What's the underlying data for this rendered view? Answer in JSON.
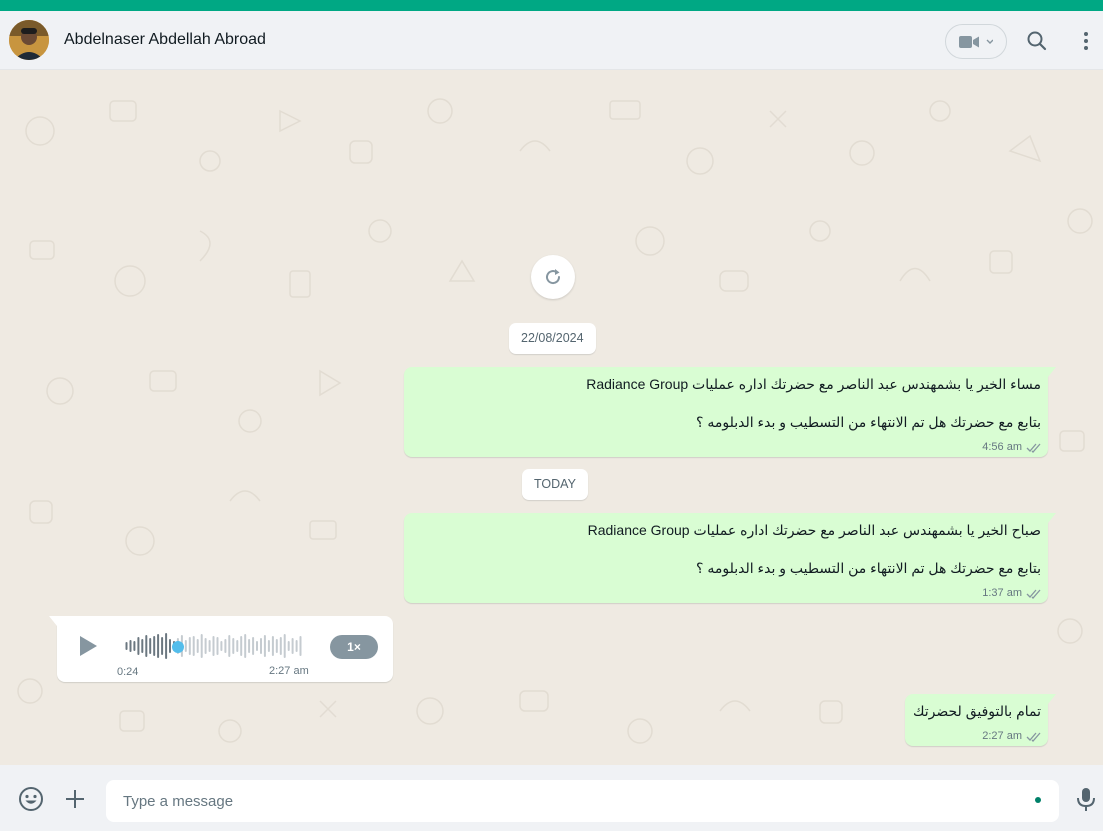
{
  "header": {
    "contact_name": "Abdelnaser Abdellah Abroad",
    "icons": [
      "avatar",
      "video-call-icon",
      "chevron-down-icon",
      "search-icon",
      "kebab-menu-icon"
    ]
  },
  "colors": {
    "accent": "#00a884",
    "outgoing_bubble": "#d9fdd3",
    "incoming_bubble": "#ffffff",
    "chat_background": "#efeae2",
    "read_ticks": "#667781",
    "voice_progress": "#53bdeb"
  },
  "chat": {
    "reload_icon": "refresh-icon",
    "date_divider_1": "22/08/2024",
    "date_divider_2": "TODAY",
    "messages": [
      {
        "direction": "outgoing",
        "line_1": "مساء الخير يا بشمهندس عبد الناصر مع  حضرتك اداره عمليات Radiance Group",
        "line_2": "بتابع مع حضرتك هل تم الانتهاء من التسطيب و بدء الدبلومه ؟",
        "time": "4:56 am",
        "status": "read"
      },
      {
        "direction": "outgoing",
        "line_1": "صباح الخير يا بشمهندس عبد الناصر مع  حضرتك اداره عمليات Radiance Group",
        "line_2": "بتابع مع حضرتك هل تم الانتهاء من التسطيب و بدء الدبلومه ؟",
        "time": "1:37 am",
        "status": "read"
      },
      {
        "direction": "incoming",
        "type": "voice",
        "duration": "0:24",
        "time": "2:27 am",
        "speed": "1×",
        "progress": 0.28
      },
      {
        "direction": "outgoing",
        "line_1": "تمام بالتوفيق لحضرتك",
        "time": "2:27 am",
        "status": "read"
      }
    ]
  },
  "composer": {
    "placeholder": "Type a message",
    "icons": [
      "emoji-icon",
      "plus-icon",
      "microphone-icon"
    ]
  }
}
